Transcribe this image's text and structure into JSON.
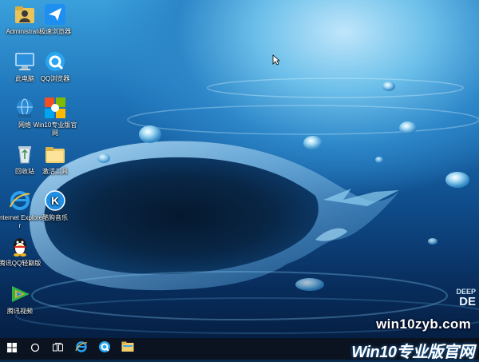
{
  "desktop": {
    "icons": [
      {
        "label": "Administrator",
        "icon": "user-folder-icon"
      },
      {
        "label": "极速浏览器",
        "icon": "paper-plane-icon"
      },
      {
        "label": "此电脑",
        "icon": "computer-icon"
      },
      {
        "label": "QQ浏览器",
        "icon": "qq-browser-icon"
      },
      {
        "label": "网络",
        "icon": "network-globe-icon"
      },
      {
        "label": "Win10专业版官网",
        "icon": "win10-logo-icon"
      },
      {
        "label": "回收站",
        "icon": "recycle-bin-icon"
      },
      {
        "label": "激活工具",
        "icon": "folder-icon"
      },
      {
        "label": "Internet Explorer",
        "icon": "internet-explorer-icon"
      },
      {
        "label": "酷狗音乐",
        "icon": "kugou-music-icon"
      },
      {
        "label": "腾讯QQ轻聊版",
        "icon": "qq-penguin-icon"
      },
      {
        "label": "腾讯视频",
        "icon": "tencent-video-icon"
      }
    ]
  },
  "watermark": {
    "text": "win10zyb.com"
  },
  "deep_brand": {
    "line1": "DEEP",
    "line2": "DE"
  },
  "taskbar": {
    "brand": "Win10专业版官网",
    "items": [
      "start-windows-icon",
      "cortana-search-icon",
      "task-view-icon",
      "internet-explorer-icon",
      "qq-browser-icon",
      "file-explorer-icon"
    ]
  },
  "colors": {
    "taskbar": "#0b1320",
    "water_light": "#6dc0ea",
    "water_dark": "#061f44"
  }
}
